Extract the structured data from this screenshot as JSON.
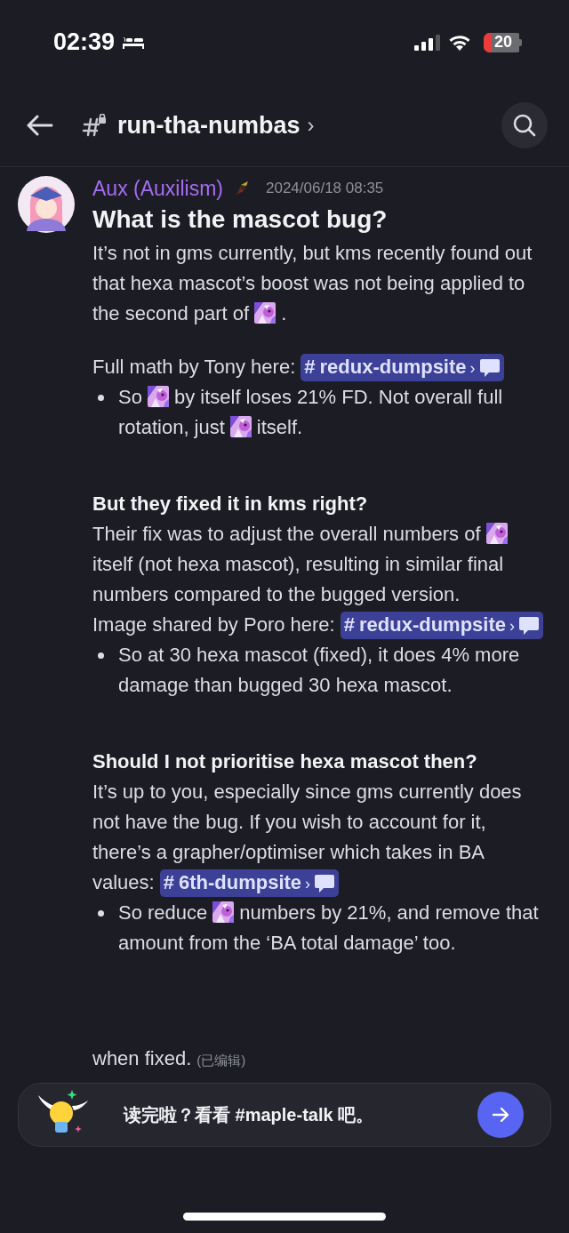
{
  "status_bar": {
    "time": "02:39",
    "battery": "20"
  },
  "header": {
    "channel": "run-tha-numbas",
    "chevron": "›"
  },
  "message": {
    "author": "Aux (Auxilism)",
    "timestamp": "2024/06/18 08:35",
    "blocks": [
      {
        "kind": "heading",
        "text": "What is the mascot bug?"
      },
      {
        "kind": "para",
        "parts": [
          {
            "kind": "text",
            "text": "It’s not in gms currently, but kms recently found out that hexa mascot’s boost was not being applied to the second part of"
          },
          {
            "kind": "emoji"
          },
          {
            "kind": "text",
            "text": "."
          }
        ]
      },
      {
        "kind": "gap"
      },
      {
        "kind": "para",
        "parts": [
          {
            "kind": "text",
            "text": "Full math by Tony here:"
          },
          {
            "kind": "mention",
            "hash": "#",
            "channel": "redux-dumpsite",
            "chevron": "›"
          }
        ]
      },
      {
        "kind": "bullet",
        "parts": [
          {
            "kind": "text",
            "text": "So"
          },
          {
            "kind": "emoji"
          },
          {
            "kind": "text",
            "text": "by itself loses 21% FD. Not overall full rotation, just"
          },
          {
            "kind": "emoji"
          },
          {
            "kind": "text",
            "text": "itself."
          }
        ]
      },
      {
        "kind": "gap"
      },
      {
        "kind": "gap"
      },
      {
        "kind": "subheading",
        "text": "But they fixed it in kms right?"
      },
      {
        "kind": "para",
        "parts": [
          {
            "kind": "text",
            "text": "Their fix was to adjust the overall numbers of"
          },
          {
            "kind": "emoji"
          },
          {
            "kind": "text",
            "text": "itself (not hexa mascot), resulting in similar final numbers compared to the bugged version."
          }
        ]
      },
      {
        "kind": "para",
        "parts": [
          {
            "kind": "text",
            "text": "Image shared by Poro here:"
          },
          {
            "kind": "mention",
            "hash": "#",
            "channel": "redux-dumpsite",
            "chevron": "›"
          }
        ]
      },
      {
        "kind": "bullet",
        "parts": [
          {
            "kind": "text",
            "text": "So at 30 hexa mascot (fixed), it does 4% more damage than bugged 30 hexa mascot."
          }
        ]
      },
      {
        "kind": "gap"
      },
      {
        "kind": "gap"
      },
      {
        "kind": "subheading",
        "text": "Should I not prioritise hexa mascot then?"
      },
      {
        "kind": "para",
        "parts": [
          {
            "kind": "text",
            "text": "It’s up to you, especially since gms currently does not have the bug. If you wish to account for it, there’s a grapher/optimiser which takes in BA values:"
          },
          {
            "kind": "mention",
            "hash": "#",
            "channel": "6th-dumpsite",
            "chevron": "›"
          }
        ]
      },
      {
        "kind": "bullet",
        "parts": [
          {
            "kind": "text",
            "text": "So reduce"
          },
          {
            "kind": "emoji"
          },
          {
            "kind": "text",
            "text": "numbers by 21%, and remove that amount from the ‘BA total damage’ too."
          }
        ]
      },
      {
        "kind": "tail",
        "parts": [
          {
            "kind": "text",
            "text": "when fixed."
          },
          {
            "kind": "edited",
            "text": "(已编辑)"
          }
        ]
      }
    ]
  },
  "banner": {
    "text": "读完啦？看看 #maple-talk 吧。"
  }
}
